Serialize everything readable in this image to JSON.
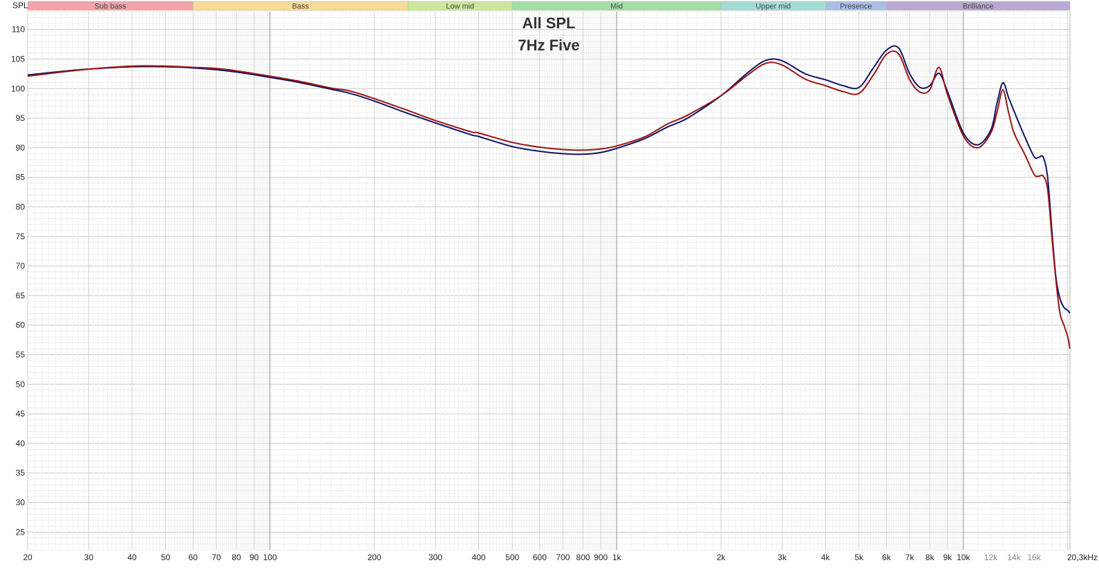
{
  "chart_data": {
    "type": "line",
    "title": "All SPL",
    "subtitle": "7Hz Five",
    "ylabel": "SPL",
    "x_unit": "Hz",
    "x_scale": "log",
    "xlim": [
      20,
      20300
    ],
    "ylim": [
      22,
      113
    ],
    "grid": true,
    "y_ticks": [
      25,
      30,
      35,
      40,
      45,
      50,
      55,
      60,
      65,
      70,
      75,
      80,
      85,
      90,
      95,
      100,
      105,
      110
    ],
    "x_tick_labels": [
      {
        "f": 20,
        "label": "20"
      },
      {
        "f": 30,
        "label": "30"
      },
      {
        "f": 40,
        "label": "40"
      },
      {
        "f": 50,
        "label": "50"
      },
      {
        "f": 60,
        "label": "60"
      },
      {
        "f": 70,
        "label": "70"
      },
      {
        "f": 80,
        "label": "80"
      },
      {
        "f": 90,
        "label": "90"
      },
      {
        "f": 100,
        "label": "100"
      },
      {
        "f": 200,
        "label": "200"
      },
      {
        "f": 300,
        "label": "300"
      },
      {
        "f": 400,
        "label": "400"
      },
      {
        "f": 500,
        "label": "500"
      },
      {
        "f": 600,
        "label": "600"
      },
      {
        "f": 700,
        "label": "700"
      },
      {
        "f": 800,
        "label": "800"
      },
      {
        "f": 900,
        "label": "900"
      },
      {
        "f": 1000,
        "label": "1k"
      },
      {
        "f": 2000,
        "label": "2k"
      },
      {
        "f": 3000,
        "label": "3k"
      },
      {
        "f": 4000,
        "label": "4k"
      },
      {
        "f": 5000,
        "label": "5k"
      },
      {
        "f": 6000,
        "label": "6k"
      },
      {
        "f": 7000,
        "label": "7k"
      },
      {
        "f": 8000,
        "label": "8k"
      },
      {
        "f": 9000,
        "label": "9k"
      },
      {
        "f": 10000,
        "label": "10k"
      },
      {
        "f": 12000,
        "label": "12k",
        "minor": true
      },
      {
        "f": 14000,
        "label": "14k",
        "minor": true
      },
      {
        "f": 16000,
        "label": "16k",
        "minor": true
      },
      {
        "f": 20300,
        "label": "20,3kHz"
      }
    ],
    "bands": [
      {
        "name": "Sub bass",
        "from": 20,
        "to": 60,
        "color": "#f4a3a8"
      },
      {
        "name": "Bass",
        "from": 60,
        "to": 250,
        "color": "#f7dc96"
      },
      {
        "name": "Low mid",
        "from": 250,
        "to": 500,
        "color": "#cfe79a"
      },
      {
        "name": "Mid",
        "from": 500,
        "to": 2000,
        "color": "#a3dfa5"
      },
      {
        "name": "Upper mid",
        "from": 2000,
        "to": 4000,
        "color": "#a5dcd3"
      },
      {
        "name": "Presence",
        "from": 4000,
        "to": 6000,
        "color": "#a9bfe6"
      },
      {
        "name": "Brilliance",
        "from": 6000,
        "to": 20300,
        "color": "#b8a9d3"
      }
    ],
    "series": [
      {
        "color": "#0d1466",
        "x": [
          20,
          25,
          30,
          40,
          50,
          60,
          70,
          80,
          100,
          120,
          150,
          170,
          200,
          250,
          300,
          380,
          400,
          500,
          600,
          700,
          800,
          900,
          1000,
          1200,
          1400,
          1600,
          2000,
          2400,
          2700,
          3000,
          3500,
          4000,
          4500,
          5000,
          5500,
          6000,
          6500,
          7000,
          7500,
          8000,
          8500,
          9000,
          10000,
          11000,
          12000,
          12500,
          13000,
          13500,
          14000,
          15000,
          16000,
          16500,
          17000,
          17500,
          18000,
          18500,
          19000,
          19500,
          20000,
          20300
        ],
        "y": [
          102.3,
          102.9,
          103.3,
          103.7,
          103.7,
          103.5,
          103.2,
          102.8,
          101.9,
          101.1,
          99.9,
          99.2,
          97.9,
          95.8,
          94.2,
          92.2,
          91.9,
          90.2,
          89.4,
          89.0,
          88.9,
          89.2,
          89.9,
          91.5,
          93.5,
          95.0,
          98.8,
          102.8,
          104.8,
          104.7,
          102.5,
          101.5,
          100.5,
          100.2,
          103.5,
          106.5,
          106.9,
          102.5,
          100.2,
          100.5,
          102.6,
          99.5,
          92.5,
          90.5,
          93.0,
          97.5,
          101.0,
          98.5,
          96.2,
          92.0,
          88.5,
          88.4,
          88.4,
          85.0,
          76.0,
          68.0,
          64.5,
          63.0,
          62.5,
          62.0
        ]
      },
      {
        "color": "#9b1313",
        "x": [
          20,
          25,
          30,
          40,
          50,
          60,
          70,
          80,
          100,
          120,
          150,
          170,
          200,
          250,
          300,
          380,
          400,
          500,
          600,
          700,
          800,
          900,
          1000,
          1200,
          1400,
          1600,
          2000,
          2400,
          2700,
          3000,
          3500,
          4000,
          4500,
          5000,
          5500,
          6000,
          6500,
          7000,
          7500,
          8000,
          8500,
          9000,
          10000,
          11000,
          12000,
          12500,
          13000,
          13500,
          14000,
          15000,
          16000,
          16500,
          17000,
          17500,
          18000,
          18500,
          19000,
          19500,
          20000,
          20300
        ],
        "y": [
          102.1,
          102.8,
          103.3,
          103.8,
          103.8,
          103.6,
          103.4,
          103.0,
          102.1,
          101.3,
          100.1,
          99.6,
          98.3,
          96.3,
          94.6,
          92.7,
          92.5,
          90.9,
          90.1,
          89.7,
          89.6,
          89.8,
          90.3,
          91.8,
          94.0,
          95.5,
          98.8,
          102.4,
          104.3,
          104.0,
          101.6,
          100.5,
          99.5,
          99.2,
          102.3,
          105.8,
          105.9,
          101.5,
          99.4,
          99.8,
          103.6,
          99.0,
          92.0,
          90.0,
          92.5,
          96.0,
          99.8,
          96.0,
          92.5,
          89.0,
          85.5,
          85.2,
          85.2,
          83.0,
          75.0,
          67.5,
          62.0,
          60.0,
          58.0,
          56.0
        ]
      }
    ]
  }
}
